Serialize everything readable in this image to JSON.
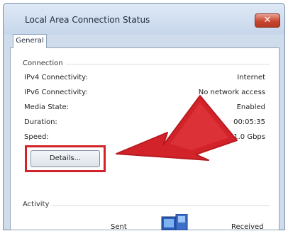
{
  "window": {
    "title": "Local Area Connection Status",
    "close_glyph": "✕"
  },
  "tabs": [
    {
      "label": "General"
    }
  ],
  "connection": {
    "heading": "Connection",
    "rows": [
      {
        "label": "IPv4 Connectivity:",
        "value": "Internet"
      },
      {
        "label": "IPv6 Connectivity:",
        "value": "No network access"
      },
      {
        "label": "Media State:",
        "value": "Enabled"
      },
      {
        "label": "Duration:",
        "value": "00:05:35"
      },
      {
        "label": "Speed:",
        "value": "1.0 Gbps"
      }
    ],
    "details_button": "Details..."
  },
  "activity": {
    "heading": "Activity",
    "sent_label": "Sent",
    "received_label": "Received"
  },
  "colors": {
    "highlight": "#d2232a",
    "arrow": "#d2232a"
  }
}
